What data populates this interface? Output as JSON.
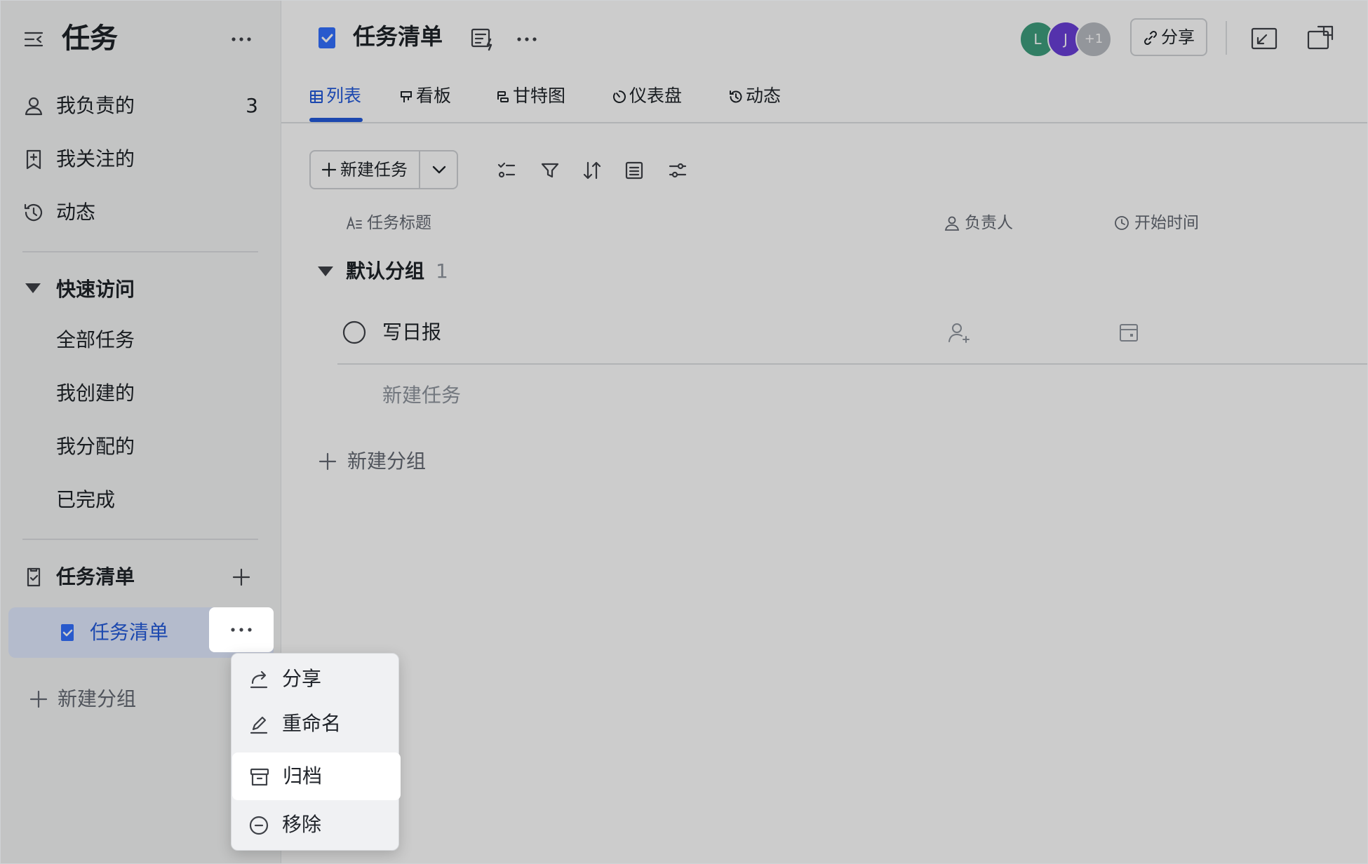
{
  "sidebar": {
    "title": "任务",
    "items": [
      {
        "label": "我负责的",
        "count": "3"
      },
      {
        "label": "我关注的"
      },
      {
        "label": "动态"
      }
    ],
    "quick_access": {
      "label": "快速访问",
      "items": [
        "全部任务",
        "我创建的",
        "我分配的",
        "已完成"
      ]
    },
    "lists_section": {
      "label": "任务清单",
      "active_list": "任务清单"
    },
    "new_group": "新建分组"
  },
  "header": {
    "title": "任务清单",
    "avatars": [
      {
        "initial": "L",
        "color": "#3e9e7e"
      },
      {
        "initial": "J",
        "color": "#6a3fd8"
      },
      {
        "initial": "+1",
        "color": "#b8bcc2"
      }
    ],
    "share_label": "分享"
  },
  "tabs": [
    {
      "label": "列表",
      "icon": "table-icon",
      "active": true
    },
    {
      "label": "看板",
      "icon": "board-icon"
    },
    {
      "label": "甘特图",
      "icon": "gantt-icon"
    },
    {
      "label": "仪表盘",
      "icon": "dashboard-icon"
    },
    {
      "label": "动态",
      "icon": "history-icon"
    }
  ],
  "toolbar": {
    "new_task_label": "新建任务"
  },
  "columns": {
    "title": "任务标题",
    "assignee": "负责人",
    "start_time": "开始时间"
  },
  "group": {
    "name": "默认分组",
    "count": "1"
  },
  "tasks": [
    {
      "title": "写日报"
    }
  ],
  "new_task_placeholder": "新建任务",
  "new_group_label": "新建分组",
  "context_menu": {
    "items": [
      {
        "label": "分享",
        "icon": "share-icon"
      },
      {
        "label": "重命名",
        "icon": "edit-icon"
      },
      {
        "label": "归档",
        "icon": "archive-icon",
        "highlighted": true
      },
      {
        "label": "移除",
        "icon": "remove-icon"
      }
    ]
  },
  "colors": {
    "accent": "#245bdb",
    "active_bg": "#e1eaff"
  }
}
